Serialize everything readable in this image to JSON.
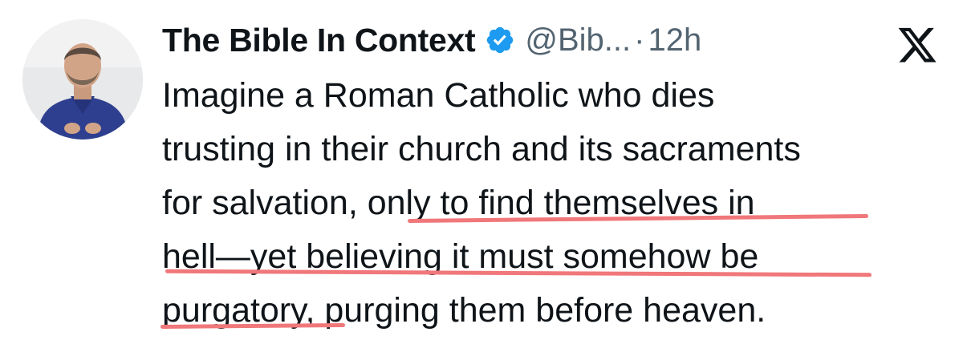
{
  "author": {
    "display_name": "The Bible In Context",
    "handle": "@Bib...",
    "dot": "·",
    "time": "12h"
  },
  "tweet": {
    "lines": [
      "Imagine a Roman Catholic who dies",
      "trusting in their church and its sacraments",
      "for salvation, only to find themselves in",
      "hell—yet believing it must somehow be",
      "purgatory, purging them before heaven."
    ]
  },
  "colors": {
    "text": "#0f1419",
    "secondary": "#536471",
    "verified": "#1d9bf0",
    "underline_highlight": "#f0777a"
  },
  "icons": {
    "verified": "verified-badge-icon",
    "platform": "x-logo-icon"
  }
}
